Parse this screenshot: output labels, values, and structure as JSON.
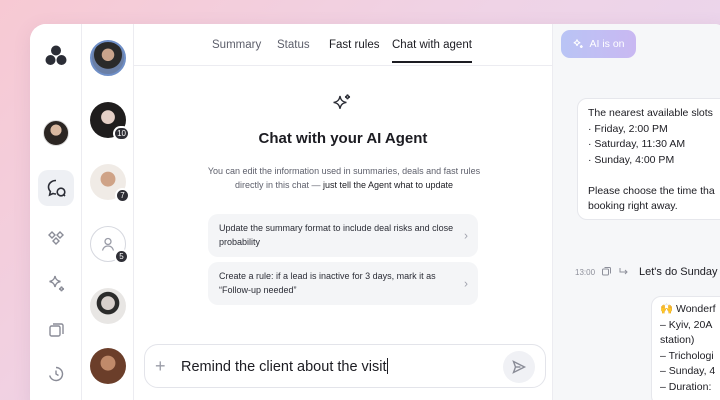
{
  "tabs": [
    {
      "label": "Summary"
    },
    {
      "label": "Status"
    },
    {
      "label": "Fast rules"
    },
    {
      "label": "Chat with agent"
    }
  ],
  "ai_pill": {
    "label": "AI is on"
  },
  "agent": {
    "title": "Chat with your AI Agent",
    "desc_part1": "You can edit the information used in summaries, deals and fast rules directly in this chat — ",
    "desc_part2": "just tell the Agent what to update"
  },
  "suggestions": [
    {
      "text": "Update the summary format to include deal risks and close probability"
    },
    {
      "text": "Create a rule: if a lead is inactive for 3 days, mark it as “Follow-up needed”"
    }
  ],
  "composer": {
    "value": "Remind the client about the visit"
  },
  "contacts": [
    {
      "badge": ""
    },
    {
      "badge": "10"
    },
    {
      "badge": "7"
    },
    {
      "badge": "5"
    },
    {
      "badge": ""
    },
    {
      "badge": ""
    }
  ],
  "chat": {
    "bubble1_lines": [
      "The nearest available slots",
      "· Friday, 2:00 PM",
      "· Saturday, 11:30 AM",
      "· Sunday, 4:00 PM",
      "",
      "Please choose the time tha",
      "booking right away."
    ],
    "time": "13:00",
    "reply": "Let's do Sunday",
    "bubble2_lines": [
      "🙌 Wonderf",
      "– Kyiv, 20A",
      "station)",
      "– Trichologi",
      "– Sunday, 4",
      "– Duration:"
    ]
  },
  "colors": {
    "accent_pill_start": "#b9c4f5",
    "accent_pill_end": "#c9b8f2",
    "active_tab": "#1c1c22"
  }
}
